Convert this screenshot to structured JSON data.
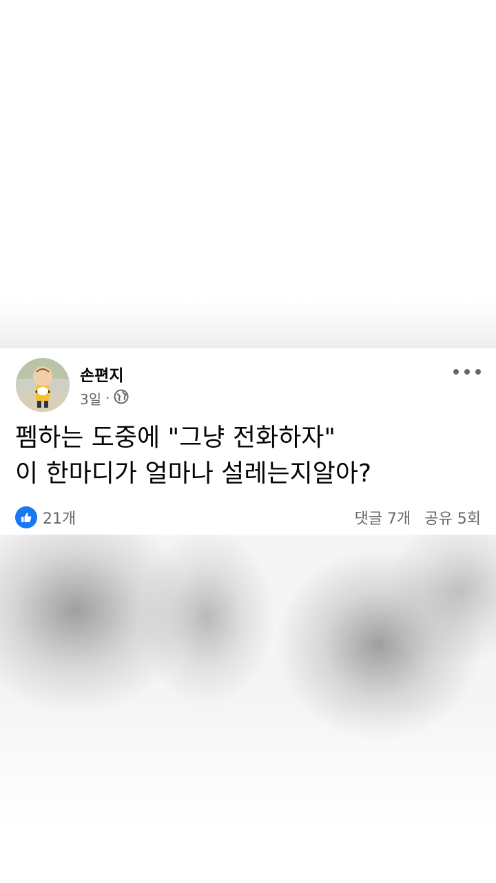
{
  "post": {
    "author": "손편지",
    "time": "3일",
    "separator": "·",
    "audience_icon": "globe-icon",
    "more_icon": "more-dots-icon",
    "text_lines": [
      "펨하는 도중에 \"그냥 전화하자\"",
      "이 한마디가 얼마나 설레는지알아?"
    ],
    "reactions": {
      "icon": "like-icon",
      "count": "21개"
    },
    "comments": "댓글 7개",
    "shares": "공유 5회"
  },
  "colors": {
    "accent": "#1877f2",
    "text_primary": "#050505",
    "text_secondary": "#65676b"
  }
}
